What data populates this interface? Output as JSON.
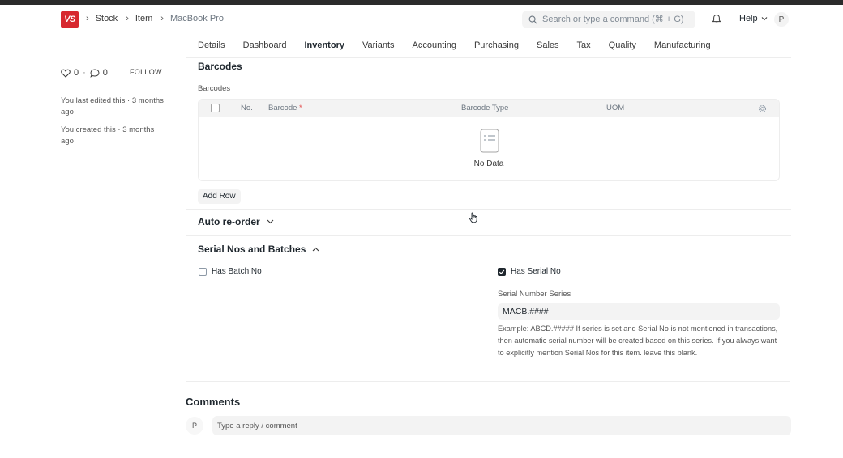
{
  "colors": {
    "brand": "#d7282f",
    "text": "#1f272e",
    "muted": "#6c7680",
    "panel": "#f3f3f3",
    "border": "#ededed"
  },
  "navbar": {
    "logo_text": "VS",
    "breadcrumbs": [
      "Stock",
      "Item",
      "MacBook Pro"
    ],
    "search_placeholder": "Search or type a command (⌘ + G)",
    "help_label": "Help",
    "avatar_initial": "P"
  },
  "sidebar": {
    "likes_count": "0",
    "comments_count": "0",
    "follow_label": "FOLLOW",
    "last_edited": "You last edited this · 3 months ago",
    "created": "You created this · 3 months ago"
  },
  "tabs": [
    {
      "label": "Details"
    },
    {
      "label": "Dashboard"
    },
    {
      "label": "Inventory",
      "active": true
    },
    {
      "label": "Variants"
    },
    {
      "label": "Accounting"
    },
    {
      "label": "Purchasing"
    },
    {
      "label": "Sales"
    },
    {
      "label": "Tax"
    },
    {
      "label": "Quality"
    },
    {
      "label": "Manufacturing"
    }
  ],
  "barcodes": {
    "section_title": "Barcodes",
    "table_label": "Barcodes",
    "columns": {
      "no": "No.",
      "barcode": "Barcode",
      "barcode_type": "Barcode Type",
      "uom": "UOM"
    },
    "required_mark": "*",
    "empty_text": "No Data",
    "add_row_label": "Add Row"
  },
  "auto_reorder": {
    "section_title": "Auto re-order"
  },
  "serial_batches": {
    "section_title": "Serial Nos and Batches",
    "has_batch_no_label": "Has Batch No",
    "has_batch_no_checked": false,
    "has_serial_no_label": "Has Serial No",
    "has_serial_no_checked": true,
    "serial_series_label": "Serial Number Series",
    "serial_series_value": "MACB.####",
    "help_text": "Example: ABCD.##### If series is set and Serial No is not mentioned in transactions, then automatic serial number will be created based on this series. If you always want to explicitly mention Serial Nos for this item. leave this blank."
  },
  "comments": {
    "title": "Comments",
    "avatar_initial": "P",
    "placeholder": "Type a reply / comment"
  }
}
